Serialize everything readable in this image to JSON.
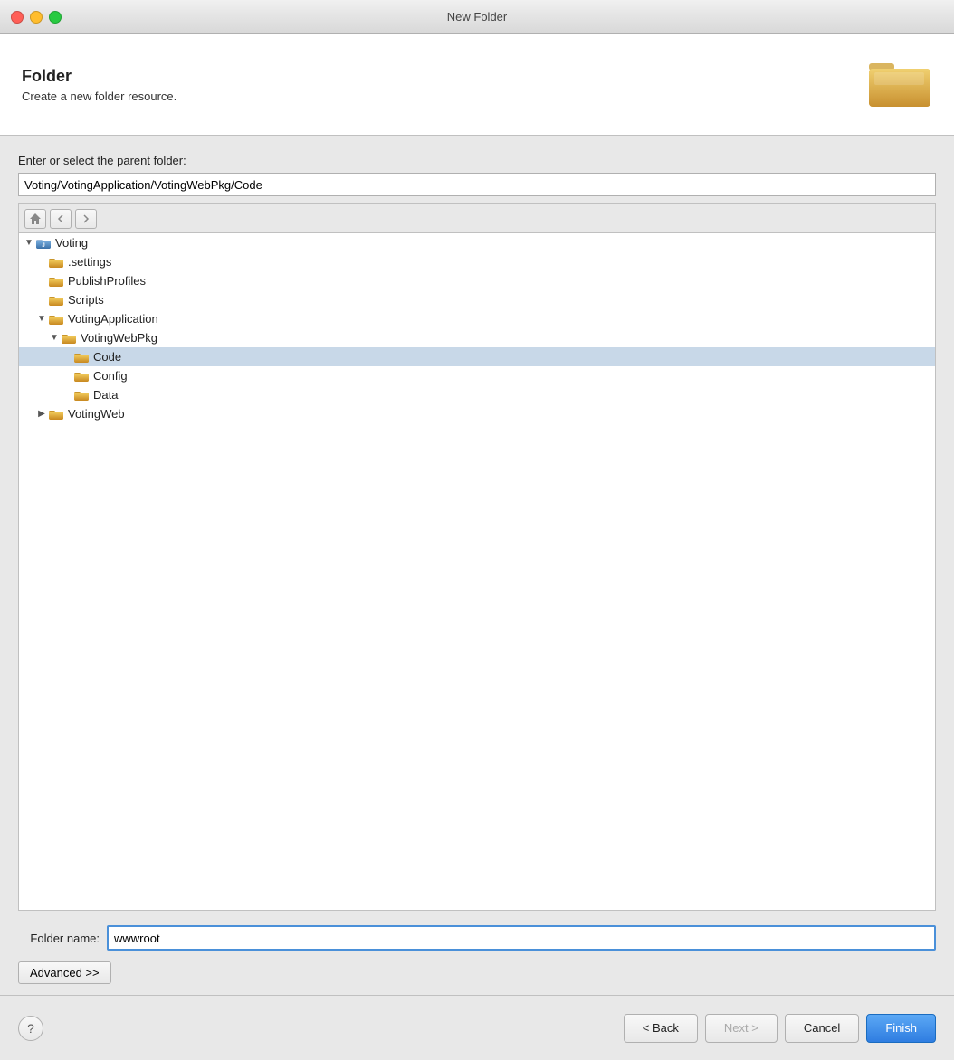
{
  "window": {
    "title": "New Folder"
  },
  "header": {
    "title": "Folder",
    "subtitle": "Create a new folder resource.",
    "folder_icon_alt": "folder"
  },
  "form": {
    "parent_label": "Enter or select the parent folder:",
    "parent_path": "Voting/VotingApplication/VotingWebPkg/Code",
    "folder_name_label": "Folder name:",
    "folder_name_value": "wwwroot",
    "advanced_button": "Advanced >>",
    "placeholder": ""
  },
  "tree": {
    "items": [
      {
        "id": "voting",
        "label": "Voting",
        "level": 0,
        "toggle": "open",
        "selected": false,
        "type": "project"
      },
      {
        "id": "settings",
        "label": ".settings",
        "level": 1,
        "toggle": "none",
        "selected": false,
        "type": "folder"
      },
      {
        "id": "publishprofiles",
        "label": "PublishProfiles",
        "level": 1,
        "toggle": "none",
        "selected": false,
        "type": "folder"
      },
      {
        "id": "scripts",
        "label": "Scripts",
        "level": 1,
        "toggle": "none",
        "selected": false,
        "type": "folder"
      },
      {
        "id": "votingapplication",
        "label": "VotingApplication",
        "level": 1,
        "toggle": "open",
        "selected": false,
        "type": "folder"
      },
      {
        "id": "votingwebpkg",
        "label": "VotingWebPkg",
        "level": 2,
        "toggle": "open",
        "selected": false,
        "type": "folder"
      },
      {
        "id": "code",
        "label": "Code",
        "level": 3,
        "toggle": "none",
        "selected": true,
        "type": "folder"
      },
      {
        "id": "config",
        "label": "Config",
        "level": 3,
        "toggle": "none",
        "selected": false,
        "type": "folder"
      },
      {
        "id": "data",
        "label": "Data",
        "level": 3,
        "toggle": "none",
        "selected": false,
        "type": "folder"
      },
      {
        "id": "votingweb",
        "label": "VotingWeb",
        "level": 1,
        "toggle": "closed",
        "selected": false,
        "type": "folder"
      }
    ]
  },
  "footer": {
    "back_label": "< Back",
    "next_label": "Next >",
    "cancel_label": "Cancel",
    "finish_label": "Finish",
    "help_icon": "?"
  },
  "colors": {
    "accent": "#2f7de1",
    "selected_bg": "#c8d8e8"
  }
}
